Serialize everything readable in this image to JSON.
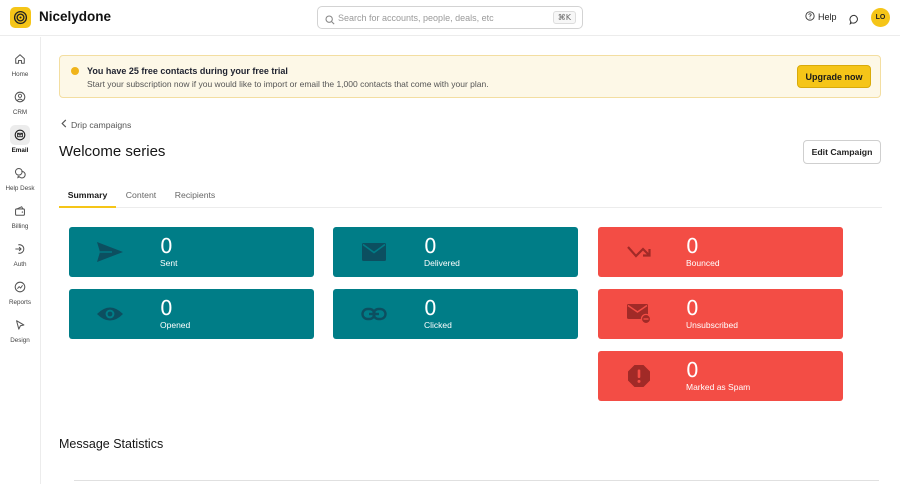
{
  "app": {
    "title": "Nicelydone",
    "logo_icon": "spiral-logo-icon",
    "accent": "#f5c518"
  },
  "header": {
    "search_placeholder": "Search for accounts, people, deals, etc",
    "search_shortcut": "⌘K",
    "help_label": "Help",
    "avatar_initials": "LO"
  },
  "sidebar": {
    "items": [
      {
        "label": "Home",
        "icon": "home-icon",
        "active": false
      },
      {
        "label": "CRM",
        "icon": "person-circle-icon",
        "active": false
      },
      {
        "label": "Email",
        "icon": "mail-icon",
        "active": true
      },
      {
        "label": "Help Desk",
        "icon": "chat-bubbles-icon",
        "active": false
      },
      {
        "label": "Billing",
        "icon": "wallet-icon",
        "active": false
      },
      {
        "label": "Auth",
        "icon": "login-icon",
        "active": false
      },
      {
        "label": "Reports",
        "icon": "chart-icon",
        "active": false
      },
      {
        "label": "Design",
        "icon": "cursor-icon",
        "active": false
      }
    ]
  },
  "banner": {
    "title": "You have 25 free contacts during your free trial",
    "subtitle": "Start your subscription now if you would like to import or email the 1,000 contacts that come with your plan.",
    "button": "Upgrade now"
  },
  "breadcrumb": {
    "back_label": "Drip campaigns"
  },
  "page": {
    "title": "Welcome series",
    "edit_button": "Edit Campaign"
  },
  "tabs": [
    {
      "label": "Summary",
      "active": true
    },
    {
      "label": "Content",
      "active": false
    },
    {
      "label": "Recipients",
      "active": false
    }
  ],
  "stats": {
    "sent": {
      "value": "0",
      "label": "Sent",
      "icon": "send-icon"
    },
    "delivered": {
      "value": "0",
      "label": "Delivered",
      "icon": "envelope-icon"
    },
    "bounced": {
      "value": "0",
      "label": "Bounced",
      "icon": "bounce-arrow-icon"
    },
    "opened": {
      "value": "0",
      "label": "Opened",
      "icon": "eye-icon"
    },
    "clicked": {
      "value": "0",
      "label": "Clicked",
      "icon": "link-icon"
    },
    "unsubscribed": {
      "value": "0",
      "label": "Unsubscribed",
      "icon": "mail-unsubscribe-icon"
    },
    "spam": {
      "value": "0",
      "label": "Marked as Spam",
      "icon": "alert-octagon-icon"
    }
  },
  "colors": {
    "success_card": "#007d87",
    "danger_card": "#f34d45"
  },
  "section": {
    "title": "Message Statistics"
  }
}
